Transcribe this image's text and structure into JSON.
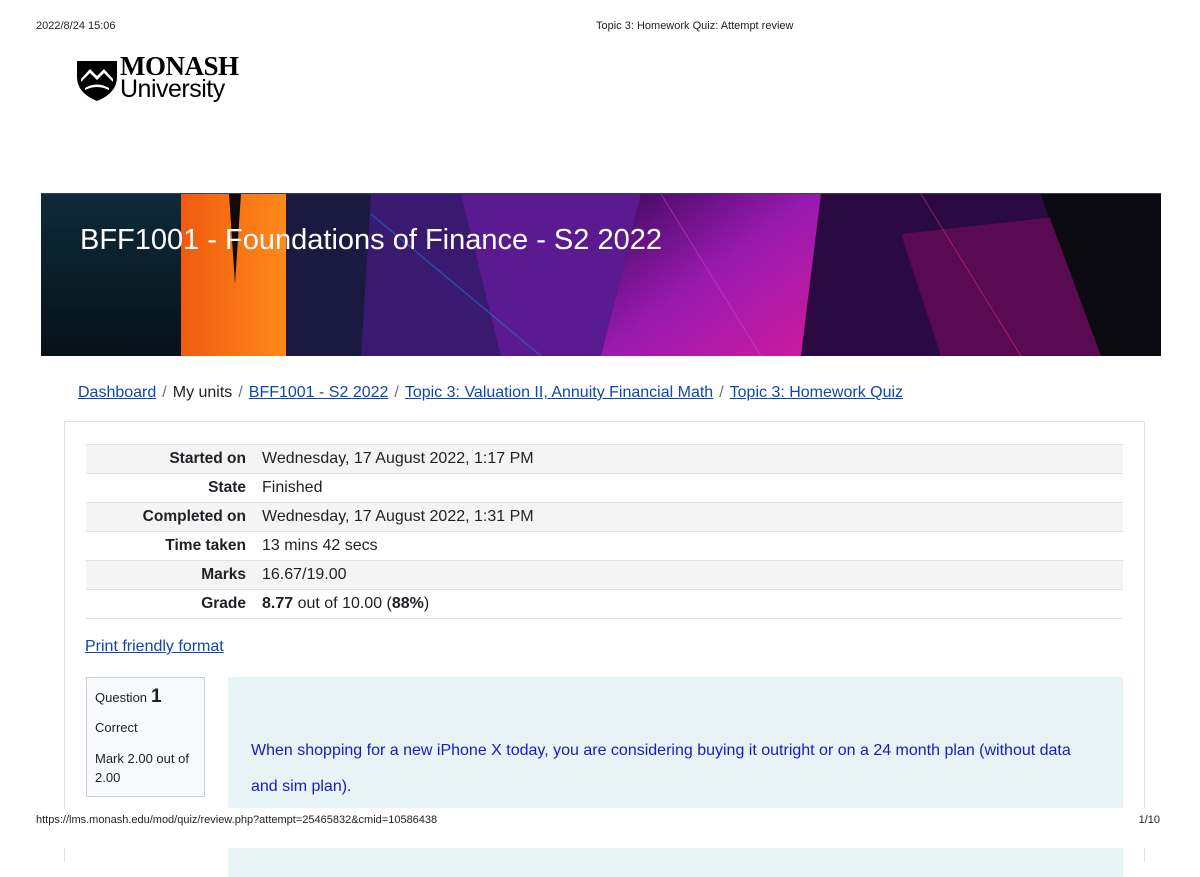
{
  "print_header": {
    "datetime": "2022/8/24 15:06",
    "title": "Topic 3: Homework Quiz: Attempt review"
  },
  "logo": {
    "line1": "MONASH",
    "line2": "University"
  },
  "banner": {
    "course_title": "BFF1001 - Foundations of Finance - S2 2022"
  },
  "breadcrumb": [
    {
      "label": "Dashboard",
      "link": true
    },
    {
      "label": "My units",
      "link": false
    },
    {
      "label": "BFF1001 - S2 2022",
      "link": true
    },
    {
      "label": "Topic 3: Valuation II, Annuity Financial Math",
      "link": true
    },
    {
      "label": "Topic 3: Homework Quiz",
      "link": true
    }
  ],
  "summary": [
    {
      "label": "Started on",
      "value": "Wednesday, 17 August 2022, 1:17 PM"
    },
    {
      "label": "State",
      "value": "Finished"
    },
    {
      "label": "Completed on",
      "value": "Wednesday, 17 August 2022, 1:31 PM"
    },
    {
      "label": "Time taken",
      "value": "13 mins 42 secs"
    },
    {
      "label": "Marks",
      "value": "16.67/19.00"
    },
    {
      "label": "Grade",
      "value_bold": "8.77",
      "value_mid": " out of 10.00 (",
      "value_pct": "88%",
      "value_end": ")"
    }
  ],
  "print_link": "Print friendly format",
  "question": {
    "prefix": "Question",
    "number": "1",
    "state": "Correct",
    "mark": "Mark 2.00 out of 2.00",
    "text": "When shopping for a new iPhone X today, you are considering buying it outright or on a 24 month plan (without data and sim plan)."
  },
  "print_footer": {
    "url": "https://lms.monash.edu/mod/quiz/review.php?attempt=25465832&cmid=10586438",
    "page": "1/10"
  },
  "colors": {
    "link": "#0f47ad",
    "question_bg": "#e7f3f5",
    "question_text": "#1a1ac4"
  }
}
